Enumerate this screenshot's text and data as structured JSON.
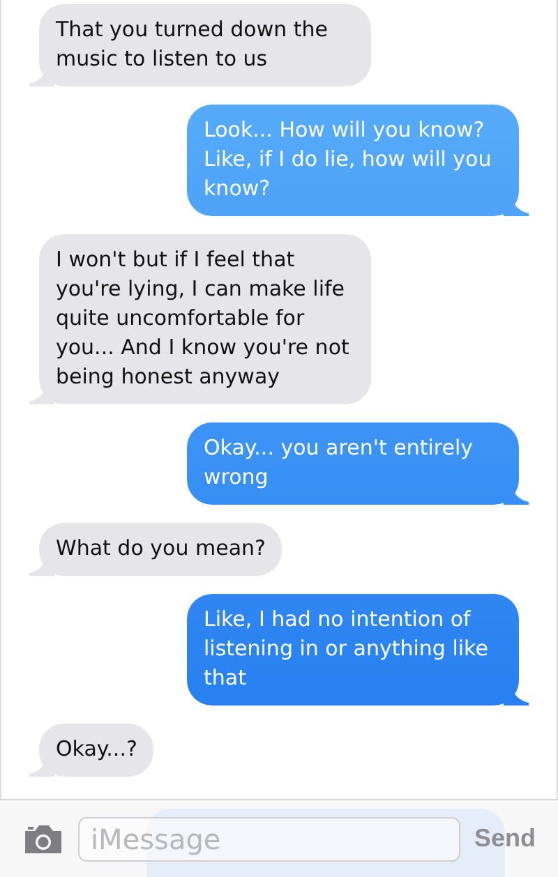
{
  "messages": [
    {
      "kind": "received",
      "text": "That you turned down the music to listen to us"
    },
    {
      "kind": "sent",
      "text": "Look... How will you know? Like, if I do lie, how will you know?"
    },
    {
      "kind": "received",
      "text": "I won't but if I feel that you're lying, I can make life quite uncomfortable for you... And I know you're not being honest anyway"
    },
    {
      "kind": "sent",
      "text": "Okay... you aren't entirely wrong"
    },
    {
      "kind": "received",
      "text": "What do you mean?"
    },
    {
      "kind": "sent",
      "text": "Like, I had no intention of listening in or anything like that"
    },
    {
      "kind": "received",
      "text": "Okay...?"
    }
  ],
  "composer": {
    "placeholder": "iMessage",
    "send": "Send"
  }
}
